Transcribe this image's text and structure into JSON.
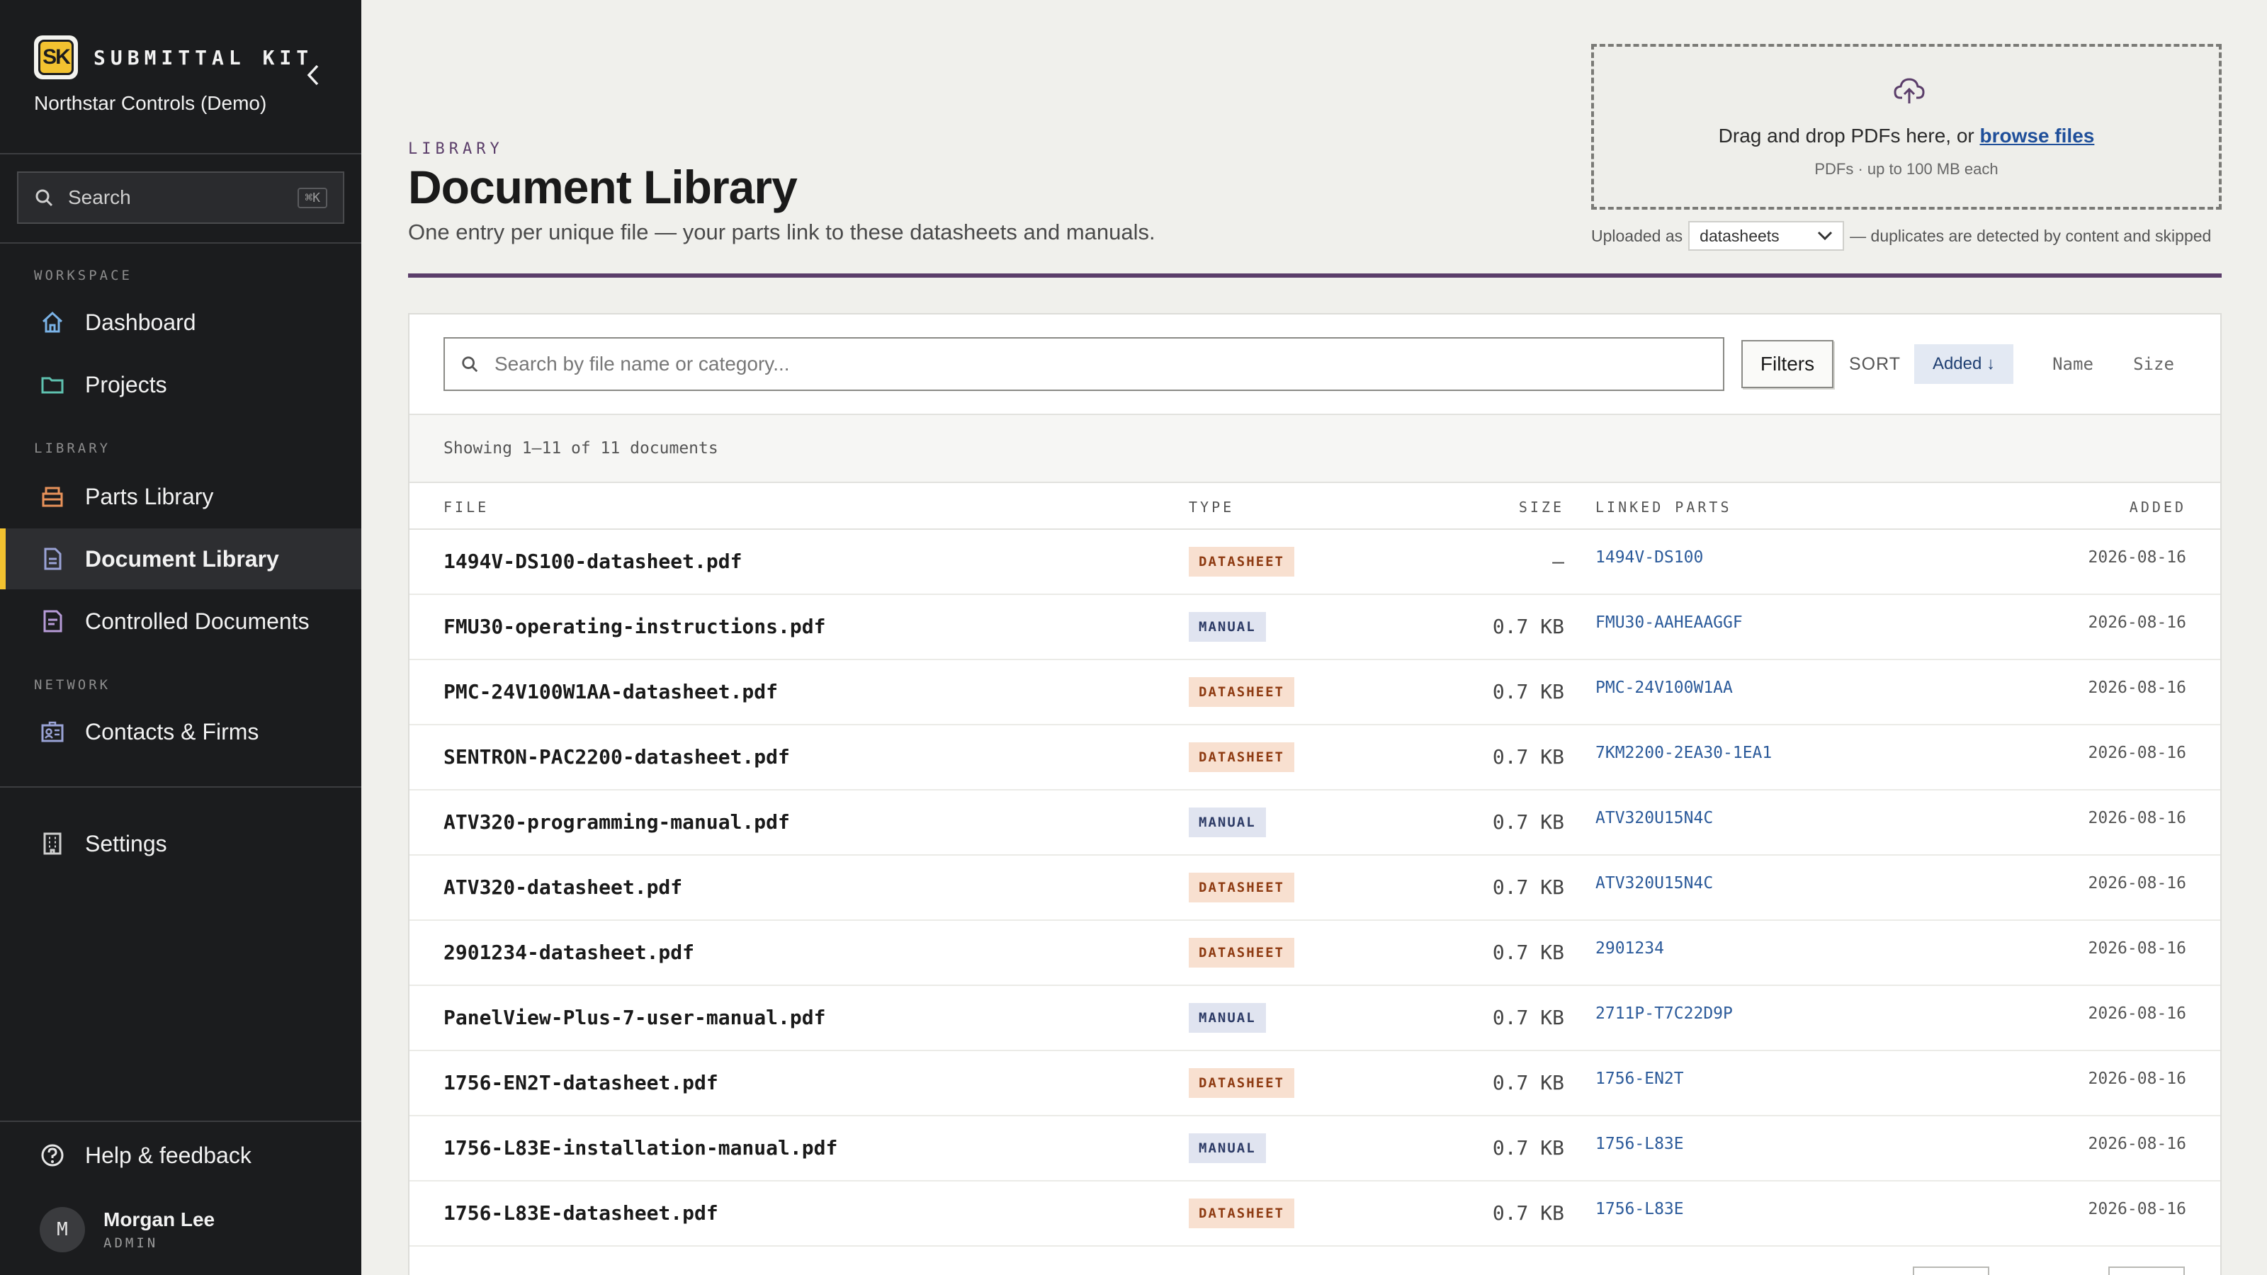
{
  "brand": {
    "logo_text": "SK",
    "name": "SUBMITTAL KIT",
    "org": "Northstar Controls (Demo)"
  },
  "sidebar": {
    "search_label": "Search",
    "search_shortcut": "⌘K",
    "sections": {
      "workspace": "WORKSPACE",
      "library": "LIBRARY",
      "network": "NETWORK"
    },
    "items": {
      "dashboard": "Dashboard",
      "projects": "Projects",
      "parts_library": "Parts Library",
      "document_library": "Document Library",
      "controlled_documents": "Controlled Documents",
      "contacts_firms": "Contacts & Firms",
      "settings": "Settings",
      "help": "Help & feedback"
    },
    "active_item": "document_library",
    "user": {
      "initial": "M",
      "name": "Morgan Lee",
      "role": "ADMIN"
    }
  },
  "header": {
    "eyebrow": "LIBRARY",
    "title": "Document Library",
    "subtitle": "One entry per unique file — your parts link to these datasheets and manuals."
  },
  "upload": {
    "drop_text": "Drag and drop PDFs here, or",
    "browse_link": "browse files",
    "hint": "PDFs · up to 100 MB each",
    "uploaded_as_label": "Uploaded as",
    "uploaded_as_value": "datasheets",
    "dedupe_note": "— duplicates are detected by content and skipped"
  },
  "toolbar": {
    "search_placeholder": "Search by file name or category...",
    "filters_label": "Filters",
    "sort_label": "SORT",
    "sort_options": {
      "added": "Added ↓",
      "name": "Name",
      "size": "Size"
    },
    "sort_active": "added"
  },
  "count_text": "Showing 1–11 of 11 documents",
  "table": {
    "headers": {
      "file": "FILE",
      "type": "TYPE",
      "size": "SIZE",
      "linked": "LINKED PARTS",
      "added": "ADDED"
    },
    "rows": [
      {
        "file": "1494V-DS100-datasheet.pdf",
        "type": "DATASHEET",
        "size": "—",
        "linked": "1494V-DS100",
        "added": "2026-08-16"
      },
      {
        "file": "FMU30-operating-instructions.pdf",
        "type": "MANUAL",
        "size": "0.7 KB",
        "linked": "FMU30-AAHEAAGGF",
        "added": "2026-08-16"
      },
      {
        "file": "PMC-24V100W1AA-datasheet.pdf",
        "type": "DATASHEET",
        "size": "0.7 KB",
        "linked": "PMC-24V100W1AA",
        "added": "2026-08-16"
      },
      {
        "file": "SENTRON-PAC2200-datasheet.pdf",
        "type": "DATASHEET",
        "size": "0.7 KB",
        "linked": "7KM2200-2EA30-1EA1",
        "added": "2026-08-16"
      },
      {
        "file": "ATV320-programming-manual.pdf",
        "type": "MANUAL",
        "size": "0.7 KB",
        "linked": "ATV320U15N4C",
        "added": "2026-08-16"
      },
      {
        "file": "ATV320-datasheet.pdf",
        "type": "DATASHEET",
        "size": "0.7 KB",
        "linked": "ATV320U15N4C",
        "added": "2026-08-16"
      },
      {
        "file": "2901234-datasheet.pdf",
        "type": "DATASHEET",
        "size": "0.7 KB",
        "linked": "2901234",
        "added": "2026-08-16"
      },
      {
        "file": "PanelView-Plus-7-user-manual.pdf",
        "type": "MANUAL",
        "size": "0.7 KB",
        "linked": "2711P-T7C22D9P",
        "added": "2026-08-16"
      },
      {
        "file": "1756-EN2T-datasheet.pdf",
        "type": "DATASHEET",
        "size": "0.7 KB",
        "linked": "1756-EN2T",
        "added": "2026-08-16"
      },
      {
        "file": "1756-L83E-installation-manual.pdf",
        "type": "MANUAL",
        "size": "0.7 KB",
        "linked": "1756-L83E",
        "added": "2026-08-16"
      },
      {
        "file": "1756-L83E-datasheet.pdf",
        "type": "DATASHEET",
        "size": "0.7 KB",
        "linked": "1756-L83E",
        "added": "2026-08-16"
      }
    ]
  },
  "colors": {
    "sidebar_bg": "#1b1c1e",
    "accent_yellow": "#f2c230",
    "accent_purple": "#5b3e6a",
    "link_blue": "#2b5a9a",
    "datasheet_badge": "#f8e0d0",
    "manual_badge": "#e0e4f0"
  },
  "icons": {
    "dashboard": "home-icon",
    "projects": "folder-icon",
    "parts_library": "box-icon",
    "document_library": "document-icon",
    "controlled_documents": "controlled-document-icon",
    "contacts_firms": "contact-card-icon",
    "settings": "building-icon",
    "help": "help-circle-icon",
    "upload": "cloud-upload-icon"
  }
}
